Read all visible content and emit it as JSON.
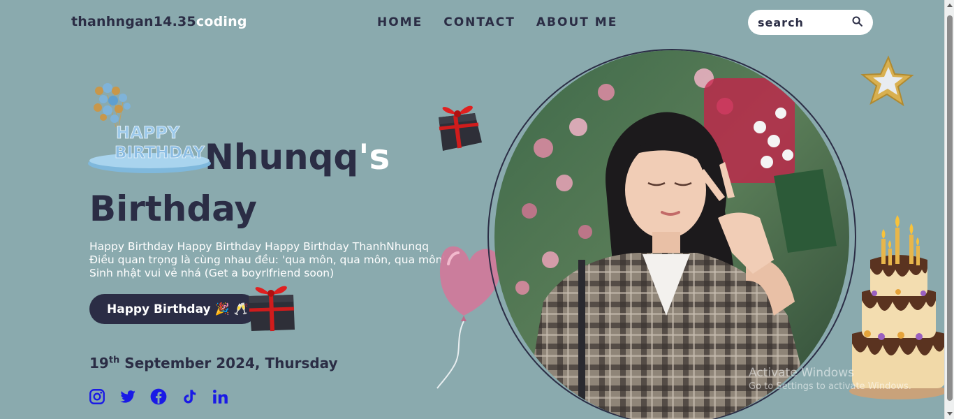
{
  "logo": {
    "dark": "thanhngan14.35",
    "light": "coding"
  },
  "nav": {
    "home": "HOME",
    "contact": "CONTACT",
    "about": "ABOUT ME"
  },
  "search": {
    "placeholder": "search"
  },
  "hero": {
    "title_partial": "Nhunqq",
    "title_apostrophe": "'s",
    "title_line2": "Birthday",
    "desc_line1": "Happy Birthday Happy Birthday Happy Birthday ThanhNhunqq",
    "desc_line2": "Điều quan trọng là cùng nhau đều: 'qua môn, qua môn, qua môn'",
    "desc_line3": "Sinh nhật vui vẻ nhá (Get a boyrlfriend soon)",
    "cta_label": "Happy Birthday 🎉 🥂",
    "date_day": "19",
    "date_suffix": "th",
    "date_rest": " September 2024, Thursday"
  },
  "decor": {
    "balloon_text_1": "HAPPY",
    "balloon_text_2": "BIRTHDAY"
  },
  "watermark": {
    "line1": "Activate Windows",
    "line2": "Go to Settings to activate Windows."
  },
  "colors": {
    "background": "#8aaaae",
    "dark": "#2b2d45",
    "accent_blue": "#1a1ae6",
    "white": "#ffffff"
  },
  "icons": [
    "instagram-icon",
    "twitter-icon",
    "facebook-icon",
    "tiktok-icon",
    "linkedin-icon"
  ]
}
